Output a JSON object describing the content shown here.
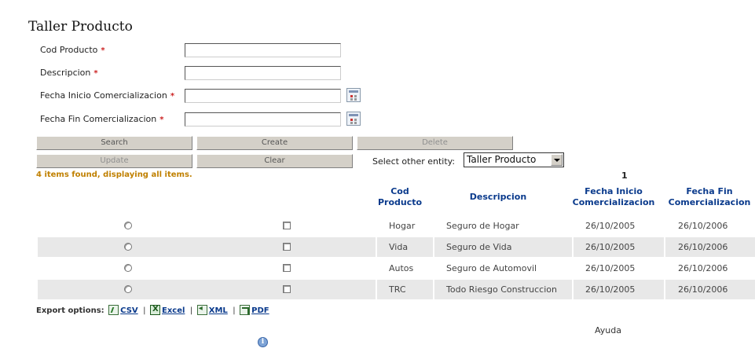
{
  "page": {
    "title": "Taller Producto"
  },
  "form": {
    "fields": [
      {
        "label": "Cod Producto",
        "required_mark": "*",
        "value": "",
        "has_calendar": false
      },
      {
        "label": "Descripcion",
        "required_mark": "*",
        "value": "",
        "has_calendar": false
      },
      {
        "label": "Fecha Inicio Comercializacion",
        "required_mark": "*",
        "value": "",
        "has_calendar": true
      },
      {
        "label": "Fecha Fin Comercializacion",
        "required_mark": "*",
        "value": "",
        "has_calendar": true
      }
    ]
  },
  "buttons": {
    "search": "Search",
    "create": "Create",
    "delete": "Delete",
    "update": "Update",
    "clear": "Clear"
  },
  "entity_selector": {
    "label": "Select other entity:",
    "selected": "Taller Producto"
  },
  "results": {
    "summary": "4 items found, displaying all items.",
    "page": "1",
    "columns": {
      "cod_line1": "Cod",
      "cod_line2": "Producto",
      "descripcion": "Descripcion",
      "inicio_line1": "Fecha Inicio",
      "inicio_line2": "Comercializacion",
      "fin_line1": "Fecha Fin",
      "fin_line2": "Comercializacion"
    },
    "rows": [
      {
        "cod": "Hogar",
        "descripcion": "Seguro de Hogar",
        "inicio": "26/10/2005",
        "fin": "26/10/2006"
      },
      {
        "cod": "Vida",
        "descripcion": "Seguro de Vida",
        "inicio": "26/10/2005",
        "fin": "26/10/2006"
      },
      {
        "cod": "Autos",
        "descripcion": "Seguro de Automovil",
        "inicio": "26/10/2005",
        "fin": "26/10/2006"
      },
      {
        "cod": "TRC",
        "descripcion": "Todo Riesgo Construccion",
        "inicio": "26/10/2005",
        "fin": "26/10/2006"
      }
    ]
  },
  "export": {
    "label": "Export options:",
    "separator": "|",
    "options": [
      {
        "label": "CSV",
        "icon": "csv-icon"
      },
      {
        "label": "Excel",
        "icon": "excel-icon"
      },
      {
        "label": "XML",
        "icon": "xml-icon"
      },
      {
        "label": "PDF",
        "icon": "pdf-icon"
      }
    ]
  },
  "help": {
    "label": "Ayuda",
    "icon": "info-icon",
    "glyph": "i"
  },
  "colors": {
    "accent": "#0a3a8c",
    "summary": "#c08000",
    "required": "#cc2222",
    "row_alt": "#e8e8e8"
  }
}
